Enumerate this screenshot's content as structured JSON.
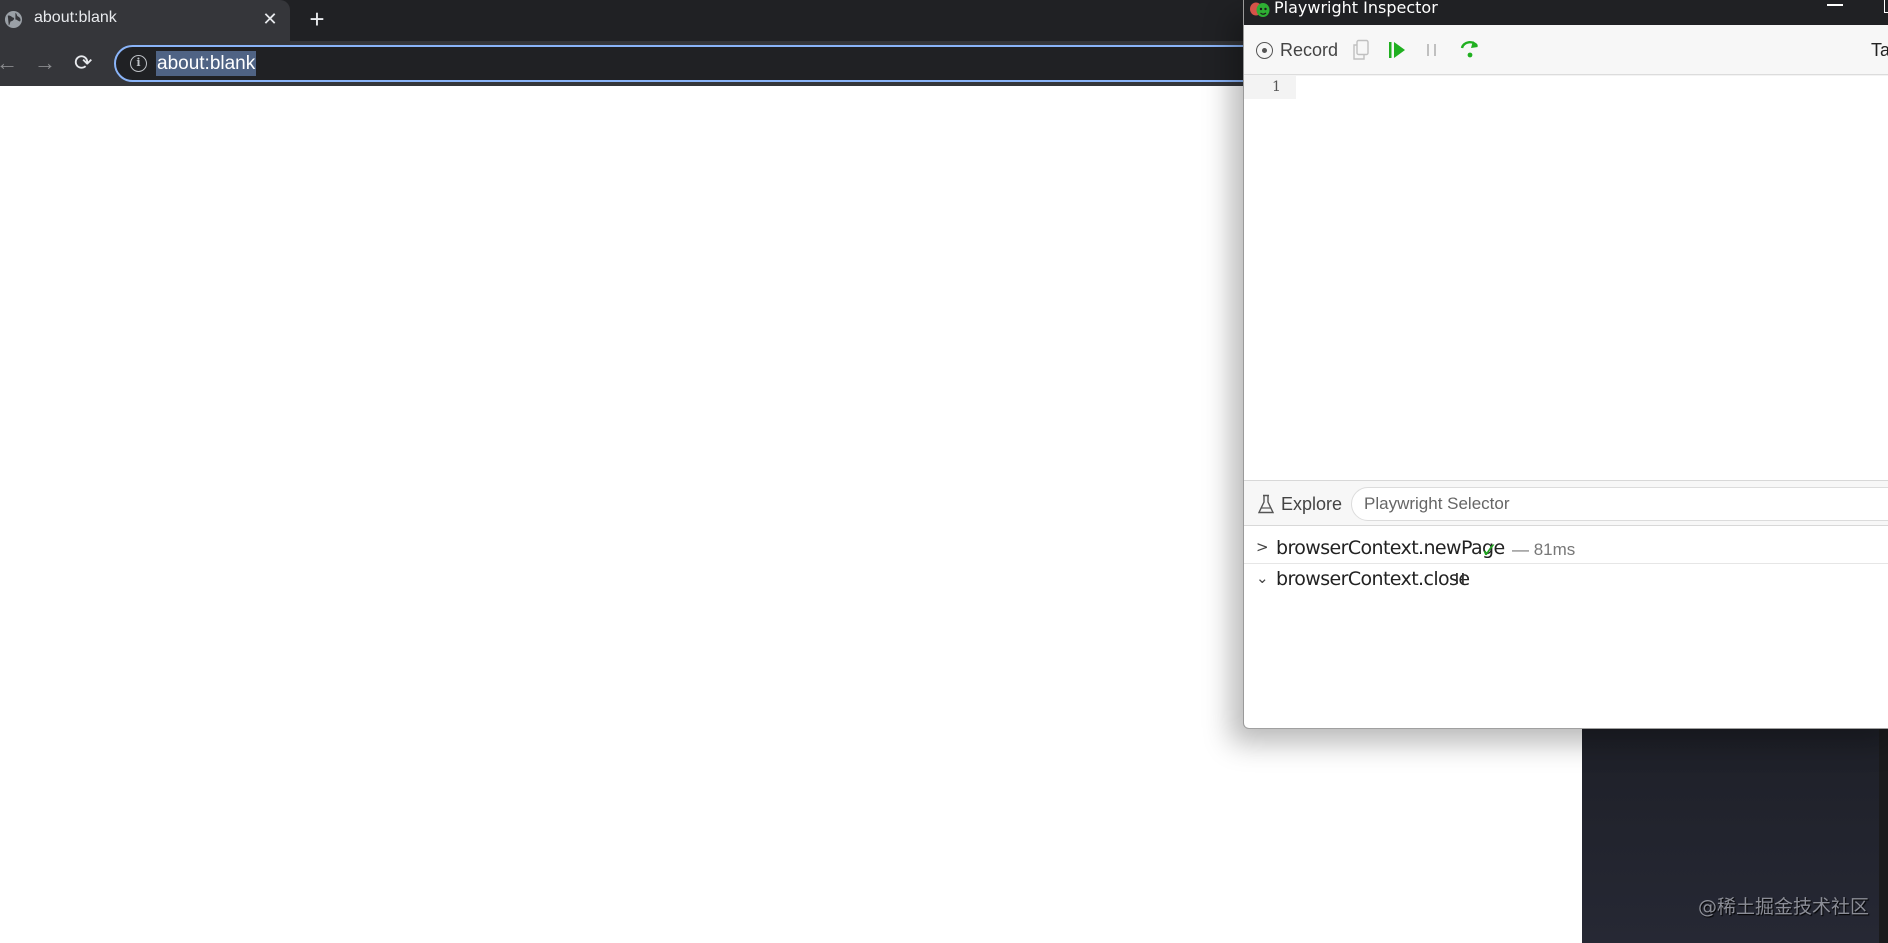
{
  "browser": {
    "tab": {
      "title": "about:blank",
      "icon": "globe-icon",
      "close_glyph": "✕"
    },
    "new_tab_glyph": "+",
    "nav": {
      "back_glyph": "←",
      "forward_glyph": "→",
      "reload_glyph": "⟳"
    },
    "address_bar": {
      "value": "about:blank",
      "info_glyph": "i"
    },
    "accent": "#8ab4f8"
  },
  "inspector": {
    "title": "Playwright Inspector",
    "toolbar": {
      "record_label": "Record",
      "target_label": "Ta",
      "colors": {
        "resume": "#20b020",
        "step": "#20b020",
        "disabled": "#c0c0c0"
      }
    },
    "editor": {
      "line_numbers": [
        "1"
      ],
      "code": ""
    },
    "explore": {
      "label": "Explore",
      "placeholder": "Playwright Selector",
      "value": ""
    },
    "log": [
      {
        "expanded": false,
        "chevron": ">",
        "method": "browserContext.newPage",
        "status": "success",
        "status_glyph": "✓",
        "duration": "— 81ms"
      },
      {
        "expanded": true,
        "chevron": "⌄",
        "method": "browserContext.close",
        "status": "paused"
      }
    ]
  },
  "watermark": "@稀土掘金技术社区"
}
